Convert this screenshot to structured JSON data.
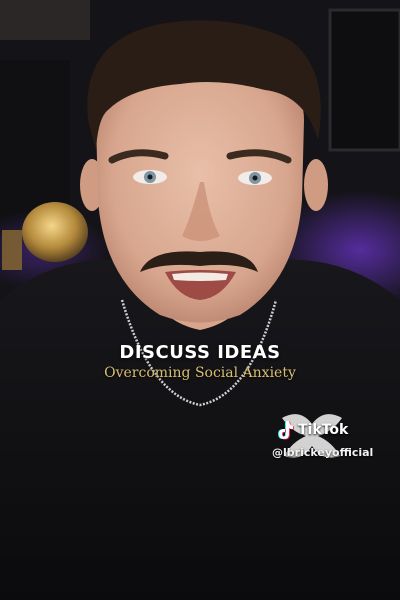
{
  "overlay": {
    "title": "DISCUSS IDEAS",
    "subtitle": "Overcoming Social Anxiety"
  },
  "watermark": {
    "brand": "TikTok",
    "handle": "@lbrickeyofficial"
  },
  "colors": {
    "title_text": "#ffffff",
    "subtitle_text": "#d9bf73",
    "background": "#141317",
    "shirt": "#111114",
    "purple_glow": "#6a35c9"
  }
}
